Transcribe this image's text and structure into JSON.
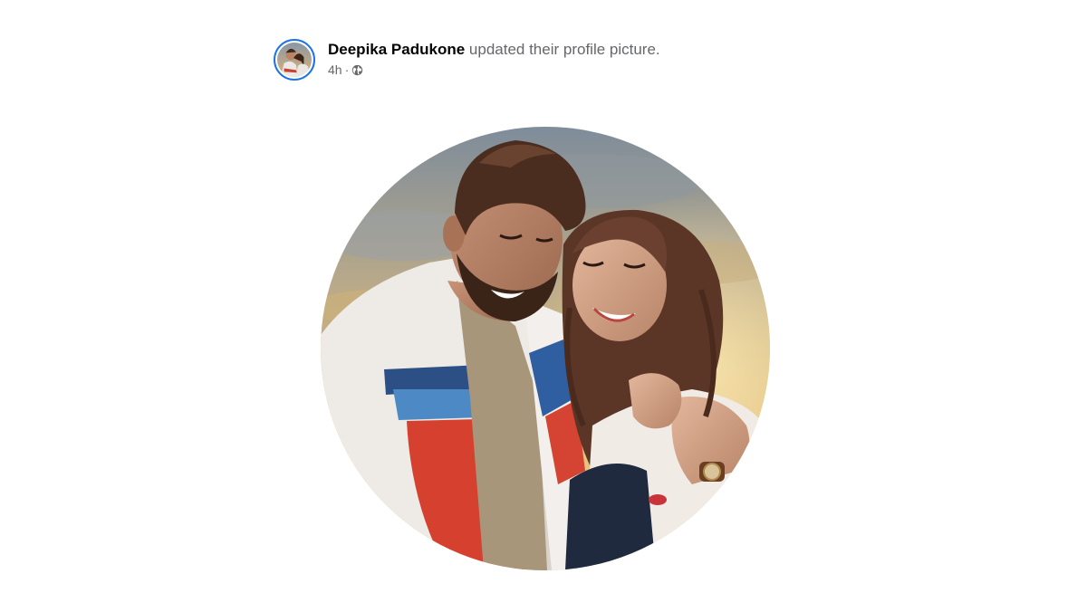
{
  "post": {
    "author_name": "Deepika Padukone",
    "action_text": "updated their profile picture.",
    "timestamp": "4h",
    "separator": "·",
    "privacy_icon": "globe-icon"
  },
  "profile_picture": {
    "shape": "circle",
    "subject": "two-people-laughing-photo"
  }
}
